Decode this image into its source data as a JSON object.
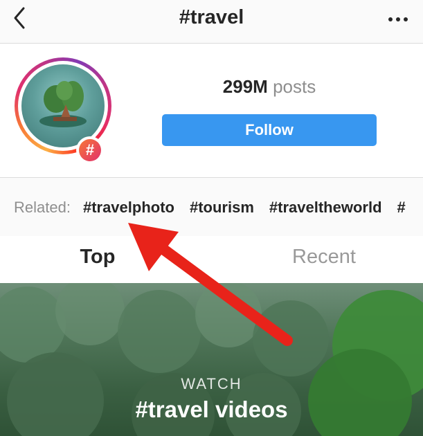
{
  "header": {
    "title": "#travel"
  },
  "profile": {
    "posts_count": "299M",
    "posts_label": "posts",
    "follow_label": "Follow",
    "hash_badge": "#"
  },
  "related": {
    "label": "Related:",
    "tags": [
      "#travelphoto",
      "#tourism",
      "#traveltheworld",
      "#"
    ]
  },
  "tabs": [
    {
      "label": "Top",
      "selected": true
    },
    {
      "label": "Recent",
      "selected": false
    }
  ],
  "featured": {
    "watch_label": "WATCH",
    "title": "#travel videos"
  },
  "colors": {
    "follow_button": "#3897f0",
    "arrow": "#e8231a",
    "tab_inactive": "#999999"
  }
}
